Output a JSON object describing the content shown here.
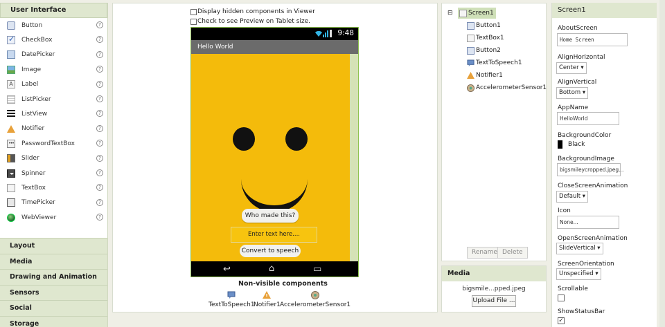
{
  "palette": {
    "header": "User Interface",
    "items": [
      {
        "label": "Button",
        "icon": "button-icon"
      },
      {
        "label": "CheckBox",
        "icon": "checkbox-icon"
      },
      {
        "label": "DatePicker",
        "icon": "datepicker-icon"
      },
      {
        "label": "Image",
        "icon": "image-icon"
      },
      {
        "label": "Label",
        "icon": "label-icon"
      },
      {
        "label": "ListPicker",
        "icon": "listpicker-icon"
      },
      {
        "label": "ListView",
        "icon": "listview-icon"
      },
      {
        "label": "Notifier",
        "icon": "notifier-icon"
      },
      {
        "label": "PasswordTextBox",
        "icon": "passwordtextbox-icon"
      },
      {
        "label": "Slider",
        "icon": "slider-icon"
      },
      {
        "label": "Spinner",
        "icon": "spinner-icon"
      },
      {
        "label": "TextBox",
        "icon": "textbox-icon"
      },
      {
        "label": "TimePicker",
        "icon": "timepicker-icon"
      },
      {
        "label": "WebViewer",
        "icon": "webviewer-icon"
      }
    ],
    "help": "?",
    "categories": [
      "Layout",
      "Media",
      "Drawing and Animation",
      "Sensors",
      "Social",
      "Storage"
    ]
  },
  "viewer": {
    "option_hidden": "Display hidden components in Viewer",
    "option_tablet": "Check to see Preview on Tablet size.",
    "status_time": "9:48",
    "screen_title": "Hello World",
    "button1": "Who made this?",
    "textbox_hint": "Enter text here....",
    "button2": "Convert to speech",
    "nonvisible_title": "Non-visible components",
    "nonvisible": [
      "TextToSpeech1",
      "Notifier1",
      "AccelerometerSensor1"
    ]
  },
  "components": {
    "tree": [
      "Screen1",
      "Button1",
      "TextBox1",
      "Button2",
      "TextToSpeech1",
      "Notifier1",
      "AccelerometerSensor1"
    ],
    "collapse": "⊟",
    "rename": "Rename",
    "delete": "Delete"
  },
  "media": {
    "header": "Media",
    "file": "bigsmile...pped.jpeg",
    "upload": "Upload File ..."
  },
  "properties": {
    "header": "Screen1",
    "about_label": "AboutScreen",
    "about_value": "Home Screen",
    "align_h_label": "AlignHorizontal",
    "align_h_value": "Center",
    "align_v_label": "AlignVertical",
    "align_v_value": "Bottom",
    "appname_label": "AppName",
    "appname_value": "HelloWorld",
    "bgcolor_label": "BackgroundColor",
    "bgcolor_value": "Black",
    "bgimage_label": "BackgroundImage",
    "bgimage_value": "bigsmileycropped.jpeg...",
    "close_anim_label": "CloseScreenAnimation",
    "close_anim_value": "Default",
    "icon_label": "Icon",
    "icon_value": "None...",
    "open_anim_label": "OpenScreenAnimation",
    "open_anim_value": "SlideVertical",
    "orientation_label": "ScreenOrientation",
    "orientation_value": "Unspecified",
    "scrollable_label": "Scrollable",
    "statusbar_label": "ShowStatusBar",
    "statusbar_check": "✓",
    "dropdown_arrow": "▾"
  },
  "colors": {
    "screen_bg": "#f4bb0b",
    "phone_border": "#8ec24f",
    "panel_header": "#dfe7cf"
  }
}
